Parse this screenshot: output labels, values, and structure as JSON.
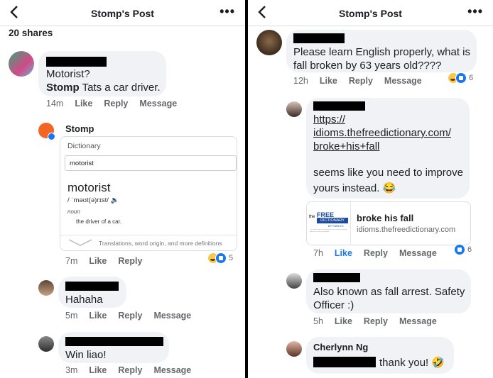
{
  "left": {
    "header": {
      "title": "Stomp's Post",
      "more": "•••"
    },
    "shares": "20 shares",
    "comments": [
      {
        "line1": "Motorist?",
        "mention": "Stomp",
        "line2": " Tats a car driver.",
        "time": "14m",
        "like": "Like",
        "reply": "Reply",
        "message": "Message"
      }
    ],
    "stomp_reply": {
      "name": "Stomp",
      "dict_header": "Dictionary",
      "dict_search": "motorist",
      "word": "motorist",
      "pron": "/ ˈməʊt(ə)rɪst/ 🔉",
      "pos": "noun",
      "def": "the driver of a car.",
      "footer": "Translations, word origin, and more definitions",
      "time": "7m",
      "like": "Like",
      "reply": "Reply",
      "react_count": "5"
    },
    "replies": [
      {
        "text": "Hahaha",
        "time": "5m",
        "like": "Like",
        "reply": "Reply",
        "message": "Message"
      },
      {
        "text": "Win liao!",
        "time": "3m",
        "like": "Like",
        "reply": "Reply",
        "message": "Message"
      }
    ]
  },
  "right": {
    "header": {
      "title": "Stomp's Post",
      "more": "•••"
    },
    "comment": {
      "text1": "Please learn English properly, what is",
      "text2": "fall broken by 63 years old????",
      "time": "12h",
      "like": "Like",
      "reply": "Reply",
      "message": "Message",
      "react_count": "6"
    },
    "reply1": {
      "l1": "https://",
      "l2": "idioms.thefreedictionary.com/",
      "l3": "broke+his+fall",
      "t1": "seems like you need to improve",
      "t2": "yours instead. 😂",
      "card_title": "broke his fall",
      "card_domain": "idioms.thefreedictionary.com",
      "logo_the": "the",
      "logo_free": "FREE",
      "logo_dict": "DICTIONARY",
      "logo_by": "BY FARLEX",
      "logo_tagline": "The world's most comprehensive free online dictionary, thesaurus and encyclopedia",
      "time": "7h",
      "like": "Like",
      "reply": "Reply",
      "message": "Message",
      "react_count": "6"
    },
    "reply2": {
      "t1": "Also known as fall arrest. Safety",
      "t2": "Officer :)",
      "time": "5h",
      "like": "Like",
      "reply": "Reply",
      "message": "Message"
    },
    "reply3": {
      "name": "Cherlynn Ng",
      "text": "thank you! 🤣"
    }
  },
  "colors": {
    "accent": "#1877f2",
    "bubble": "#f0f2f5",
    "meta": "#65676b"
  }
}
